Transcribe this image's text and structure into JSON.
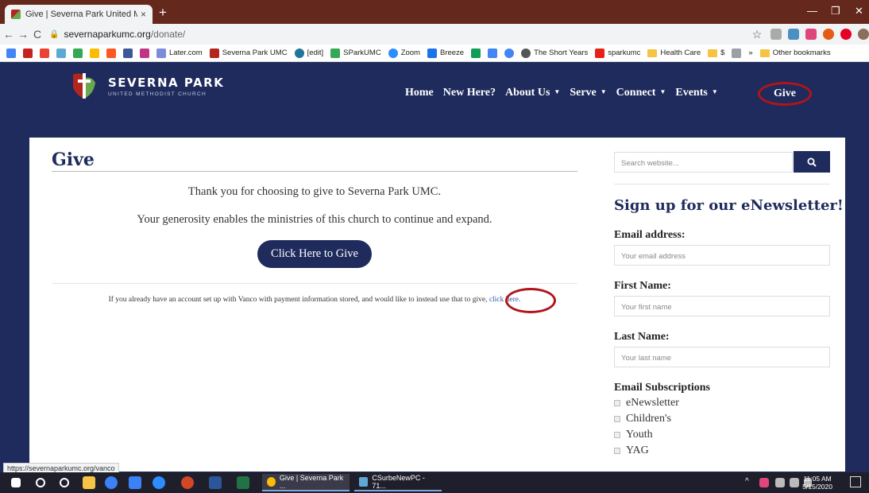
{
  "browser": {
    "tab_title": "Give | Severna Park United Metho",
    "tab_close": "×",
    "new_tab": "+",
    "minimize": "—",
    "restore": "❐",
    "close": "✕",
    "url_host": "severnaparkumc.org",
    "url_path": "/donate/",
    "back": "←",
    "forward": "→",
    "reload": "C",
    "star": "☆",
    "status_url": "https://severnaparkumc.org/vanco"
  },
  "bookmarks": [
    {
      "label": "Later.com",
      "color": "#7b8cdb"
    },
    {
      "label": "Severna Park UMC",
      "color": "#b3261e"
    },
    {
      "label": "[edit]",
      "color": "#21759b"
    },
    {
      "label": "SParkUMC",
      "color": "#34a853"
    },
    {
      "label": "Zoom",
      "color": "#2d8cff"
    },
    {
      "label": "Breeze",
      "color": "#1a73e8"
    },
    {
      "label": "The Short Years",
      "color": "#555555"
    },
    {
      "label": "sparkumc",
      "color": "#e62117"
    },
    {
      "label": "Health Care",
      "color": "#f6c344"
    },
    {
      "label": "$",
      "color": "#f6c344"
    }
  ],
  "bookmarks_more": "»",
  "bookmarks_other": "Other bookmarks",
  "site": {
    "logo_name": "SEVERNA PARK",
    "logo_sub": "UNITED METHODIST CHURCH",
    "nav": [
      {
        "label": "Home",
        "caret": ""
      },
      {
        "label": "New Here?",
        "caret": ""
      },
      {
        "label": "About Us",
        "caret": "▼"
      },
      {
        "label": "Serve",
        "caret": "▼"
      },
      {
        "label": "Connect",
        "caret": "▼"
      },
      {
        "label": "Events",
        "caret": "▼"
      }
    ],
    "nav_give": "Give",
    "accent": "#1e2b5c",
    "highlight": "#b0151b"
  },
  "main": {
    "title": "Give",
    "thanks": "Thank you for choosing to give to Severna Park UMC.",
    "generosity": "Your generosity enables the ministries of this church to continue and expand.",
    "give_button": "Click Here to Give",
    "vanco_text": "If you already have an account set up with Vanco with payment information stored, and would like to instead use that to give,",
    "vanco_link": "click here."
  },
  "sidebar": {
    "search_placeholder": "Search website...",
    "newsletter_title": "Sign up for our eNewsletter!",
    "email_label": "Email address:",
    "email_placeholder": "Your email address",
    "first_label": "First Name:",
    "first_placeholder": "Your first name",
    "last_label": "Last Name:",
    "last_placeholder": "Your last name",
    "subs_label": "Email Subscriptions",
    "subscriptions": [
      "eNewsletter",
      "Children's",
      "Youth",
      "YAG"
    ]
  },
  "taskbar": {
    "app1": "Give | Severna Park ...",
    "app2": "CSurbeNewPC - 71...",
    "time": "11:05 AM",
    "date": "5/15/2020",
    "tray": "^"
  }
}
